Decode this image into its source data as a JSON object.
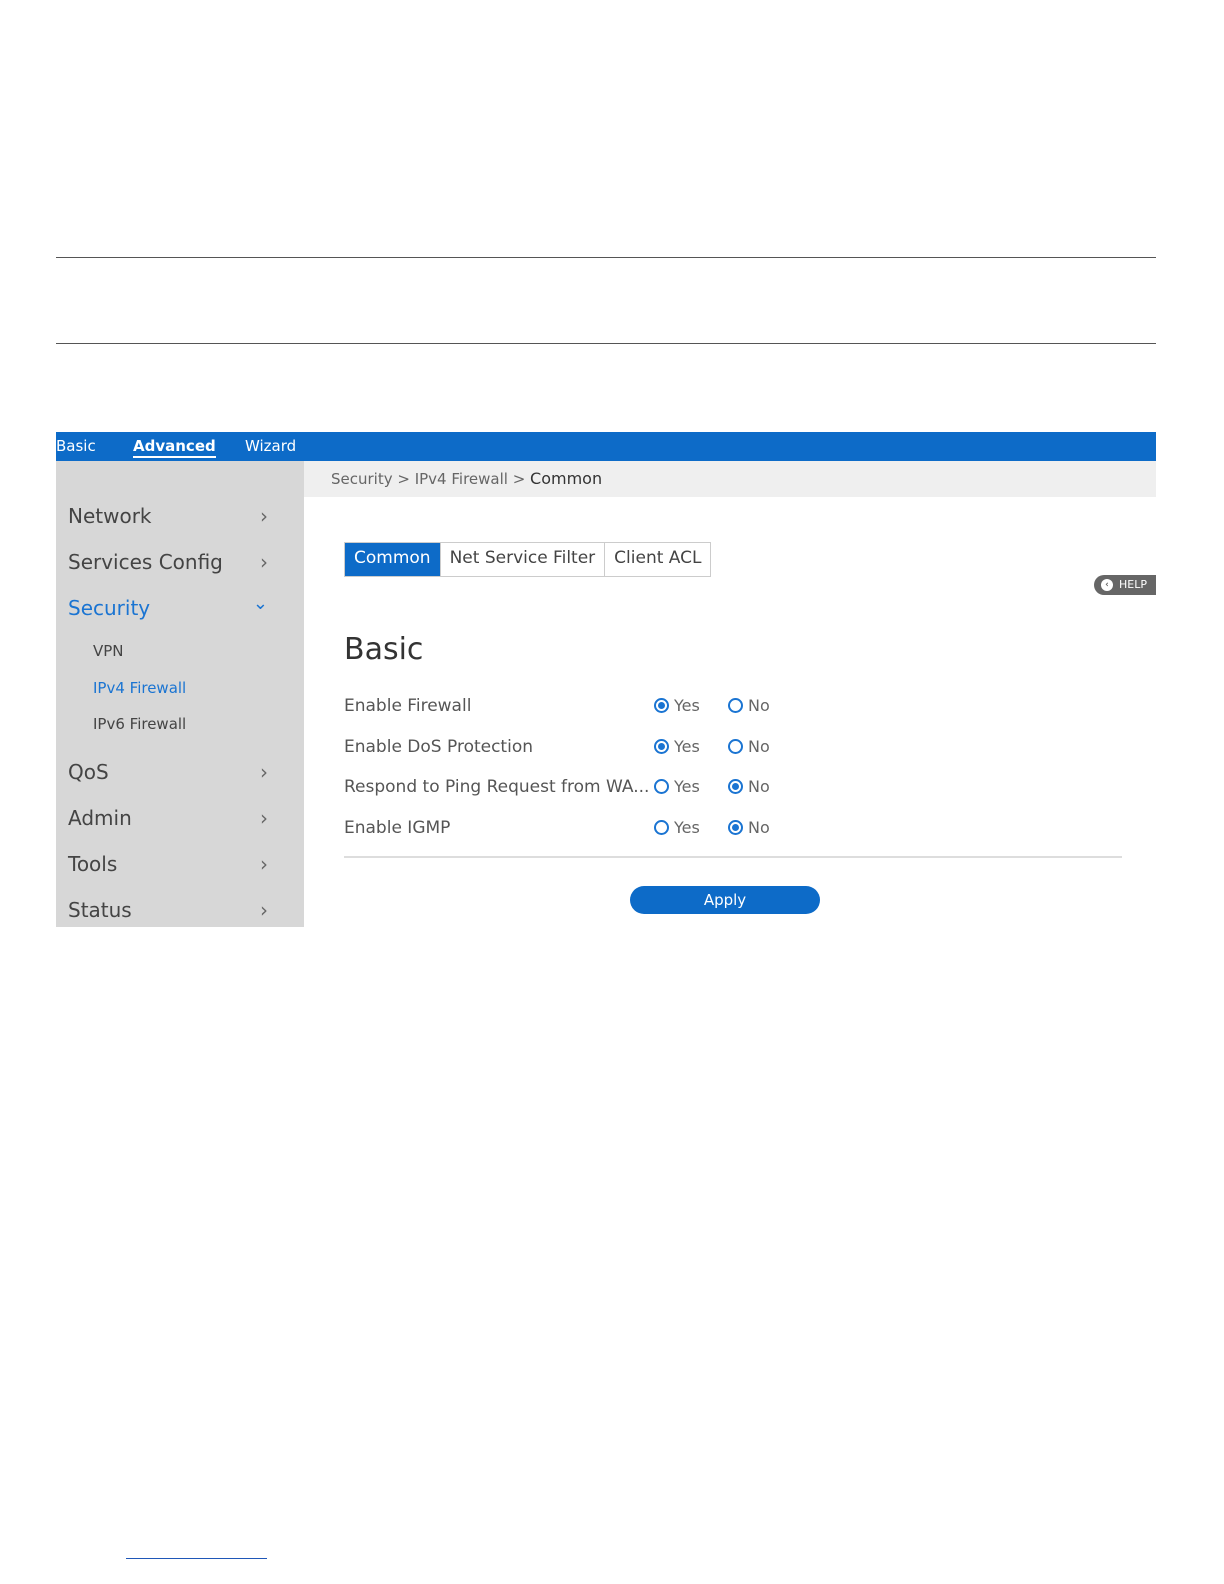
{
  "top_nav": {
    "basic": "Basic",
    "advanced": "Advanced",
    "wizard": "Wizard"
  },
  "sidebar": {
    "items": [
      {
        "label": "Network",
        "icon": "chevron-right-icon"
      },
      {
        "label": "Services Config",
        "icon": "chevron-right-icon"
      },
      {
        "label": "Security",
        "icon": "chevron-down-icon",
        "active": true
      },
      {
        "label": "QoS",
        "icon": "chevron-right-icon"
      },
      {
        "label": "Admin",
        "icon": "chevron-right-icon"
      },
      {
        "label": "Tools",
        "icon": "chevron-right-icon"
      },
      {
        "label": "Status",
        "icon": "chevron-right-icon"
      }
    ],
    "security_sub": [
      {
        "label": "VPN"
      },
      {
        "label": "IPv4 Firewall",
        "active": true
      },
      {
        "label": "IPv6 Firewall"
      }
    ],
    "chevron_right": "›",
    "chevron_down": "⌄"
  },
  "breadcrumb": {
    "path": "Security > IPv4 Firewall > ",
    "current": "Common"
  },
  "tabs": [
    {
      "label": "Common",
      "active": true
    },
    {
      "label": "Net Service Filter"
    },
    {
      "label": "Client ACL"
    }
  ],
  "help": {
    "label": "HELP",
    "icon": "arrow-left-icon",
    "glyph": "‹"
  },
  "section": {
    "title": "Basic"
  },
  "settings": [
    {
      "label": "Enable Firewall",
      "yes": "Yes",
      "no": "No",
      "value": "Yes"
    },
    {
      "label": "Enable DoS Protection",
      "yes": "Yes",
      "no": "No",
      "value": "Yes"
    },
    {
      "label": "Respond to Ping Request from WA...",
      "yes": "Yes",
      "no": "No",
      "value": "No"
    },
    {
      "label": "Enable IGMP",
      "yes": "Yes",
      "no": "No",
      "value": "No"
    }
  ],
  "apply_label": "Apply",
  "colors": {
    "accent": "#0d6bc8",
    "active_text": "#1a74d2",
    "sidebar_bg": "#d7d7d7"
  }
}
